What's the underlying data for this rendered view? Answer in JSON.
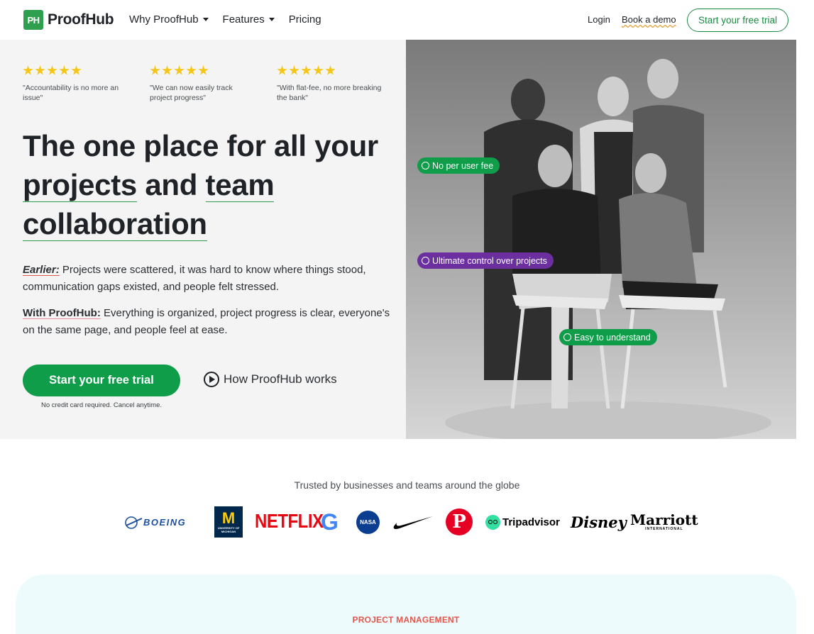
{
  "nav": {
    "logo_mark": "PH",
    "logo_text": "ProofHub",
    "menu": [
      {
        "label": "Why ProofHub",
        "dropdown": true
      },
      {
        "label": "Features",
        "dropdown": true
      },
      {
        "label": "Pricing",
        "dropdown": false
      }
    ],
    "login": "Login",
    "demo": "Book a demo",
    "cta": "Start your free trial"
  },
  "hero": {
    "reviews": [
      {
        "rating": 5,
        "quote": "\"Accountability is no more an issue\""
      },
      {
        "rating": 5,
        "quote": "\"We can now easily track project progress\""
      },
      {
        "rating": 5,
        "quote": "\"With flat-fee, no more breaking the bank\""
      }
    ],
    "headline": {
      "part1": "The one place for all your",
      "highlight1": "projects",
      "and": " and ",
      "highlight2": "team",
      "highlight3": "collaboration"
    },
    "earlier_label": "Earlier:",
    "earlier_text": " Projects were scattered, it was hard to know where things stood, communication gaps existed, and people felt stressed.",
    "with_label": "With ProofHub:",
    "with_text": " Everything is organized, project progress is clear, everyone's on the same page, and people feel at ease.",
    "cta": "Start your free trial",
    "cta_note": "No credit card required. Cancel anytime.",
    "how": "How ProofHub works"
  },
  "photo_tags": [
    {
      "label": "No per user fee",
      "color": "#0f9d4a"
    },
    {
      "label": "Ultimate control over projects",
      "color": "#6b2fa0"
    },
    {
      "label": "Easy to understand",
      "color": "#0f9d4a"
    }
  ],
  "trusted": {
    "heading": "Trusted by businesses and teams around the globe",
    "logos": [
      "Boeing",
      "University of Michigan",
      "Netflix",
      "Google",
      "NASA",
      "Nike",
      "Pinterest",
      "Tripadvisor",
      "Disney",
      "Marriott"
    ],
    "logo_text": {
      "boeing": "BOEING",
      "umich_m": "M",
      "umich_sub": "UNIVERSITY OF MICHIGAN",
      "netflix": "NETFLIX",
      "google": "G",
      "nasa": "NASA",
      "pinterest": "P",
      "tripadvisor": "Tripadvisor",
      "disney": "Disney",
      "marriott": "Marriott",
      "marriott_sub": "INTERNATIONAL"
    }
  },
  "next_section": {
    "label": "PROJECT MANAGEMENT"
  },
  "colors": {
    "brand_green": "#0f9d4a",
    "accent_purple": "#6b2fa0",
    "label_red": "#e2574c",
    "star_yellow": "#f5c518"
  }
}
